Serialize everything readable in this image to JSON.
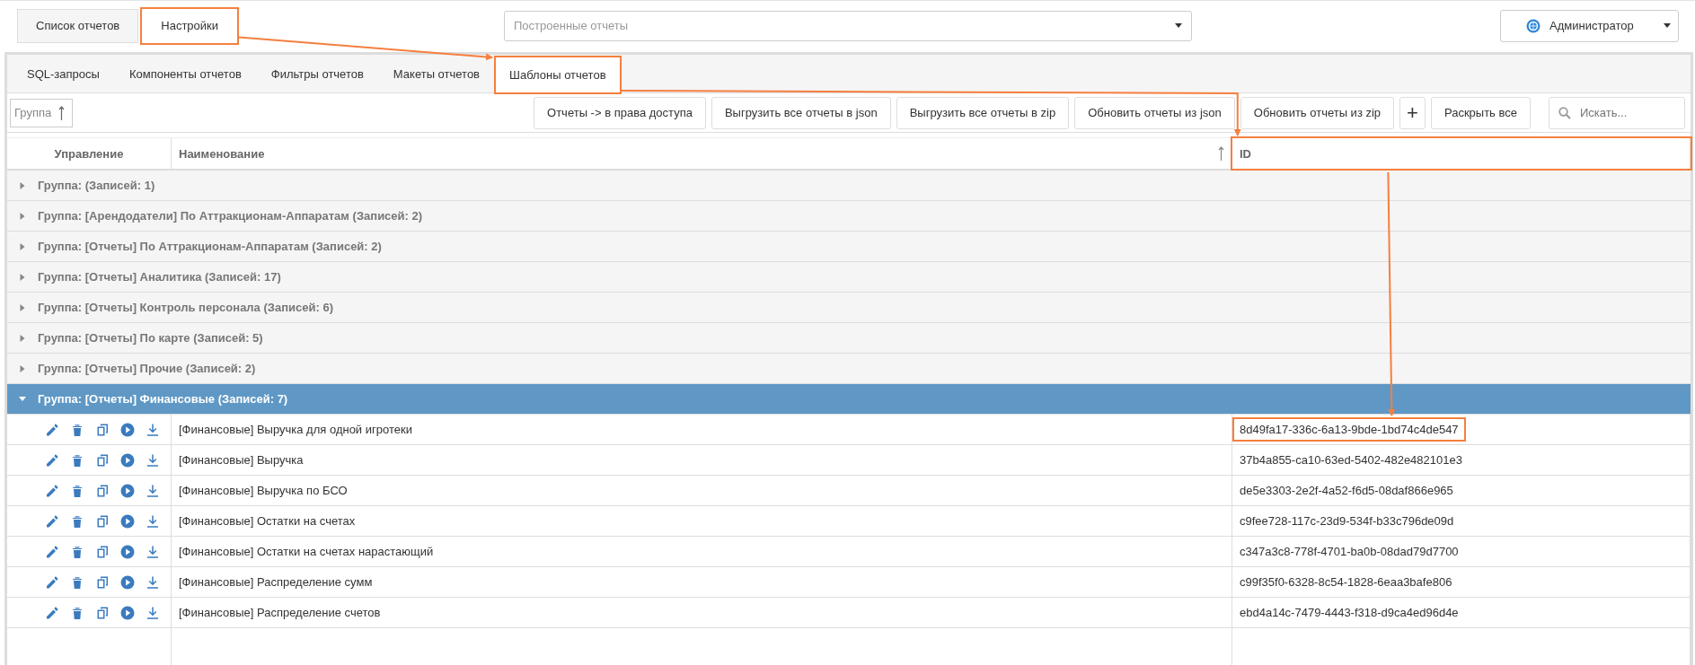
{
  "top_tabs": [
    {
      "label": "Список отчетов",
      "selected": false,
      "highlighted": false
    },
    {
      "label": "Настройки",
      "selected": true,
      "highlighted": true
    }
  ],
  "report_select": {
    "placeholder": "Построенные отчеты"
  },
  "user_menu": {
    "label": "Администратор"
  },
  "settings_tabs": [
    {
      "label": "SQL-запросы",
      "selected": false,
      "highlighted": false
    },
    {
      "label": "Компоненты отчетов",
      "selected": false,
      "highlighted": false
    },
    {
      "label": "Фильтры отчетов",
      "selected": false,
      "highlighted": false
    },
    {
      "label": "Макеты отчетов",
      "selected": false,
      "highlighted": false
    },
    {
      "label": "Шаблоны отчетов",
      "selected": true,
      "highlighted": true
    }
  ],
  "toolbar": {
    "group_chip": {
      "label": "Группа"
    },
    "buttons": [
      {
        "label": "Отчеты -> в права доступа",
        "kind": "text"
      },
      {
        "label": "Выгрузить все отчеты в json",
        "kind": "text"
      },
      {
        "label": "Выгрузить все отчеты в zip",
        "kind": "text"
      },
      {
        "label": "Обновить отчеты из json",
        "kind": "text"
      },
      {
        "label": "Обновить отчеты из zip",
        "kind": "text"
      },
      {
        "label": "+",
        "kind": "symbol"
      },
      {
        "label": "Раскрыть все",
        "kind": "text"
      }
    ],
    "search": {
      "placeholder": "Искать..."
    }
  },
  "table": {
    "columns": [
      {
        "label": "Управление",
        "sorted": false,
        "highlighted": false
      },
      {
        "label": "Наименование",
        "sorted": true,
        "highlighted": false
      },
      {
        "label": "ID",
        "sorted": false,
        "highlighted": true
      }
    ],
    "groups": [
      {
        "label": "Группа: (Записей: 1)",
        "expanded": false
      },
      {
        "label": "Группа: [Арендодатели] По Аттракционам-Аппаратам (Записей: 2)",
        "expanded": false
      },
      {
        "label": "Группа: [Отчеты] По Аттракционам-Аппаратам (Записей: 2)",
        "expanded": false
      },
      {
        "label": "Группа: [Отчеты] Аналитика (Записей: 17)",
        "expanded": false
      },
      {
        "label": "Группа: [Отчеты] Контроль персонала (Записей: 6)",
        "expanded": false
      },
      {
        "label": "Группа: [Отчеты] По карте (Записей: 5)",
        "expanded": false
      },
      {
        "label": "Группа: [Отчеты] Прочие (Записей: 2)",
        "expanded": false
      },
      {
        "label": "Группа: [Отчеты] Финансовые (Записей: 7)",
        "expanded": true,
        "rows": [
          {
            "name": "[Финансовые] Выручка для одной игротеки",
            "id": "8d49fa17-336c-6a13-9bde-1bd74c4de547",
            "id_highlighted": true
          },
          {
            "name": "[Финансовые] Выручка",
            "id": "37b4a855-ca10-63ed-5402-482e482101e3",
            "id_highlighted": false
          },
          {
            "name": "[Финансовые] Выручка по БСО",
            "id": "de5e3303-2e2f-4a52-f6d5-08daf866e965",
            "id_highlighted": false
          },
          {
            "name": "[Финансовые] Остатки на счетах",
            "id": "c9fee728-117c-23d9-534f-b33c796de09d",
            "id_highlighted": false
          },
          {
            "name": "[Финансовые] Остатки на счетах нарастающий",
            "id": "c347a3c8-778f-4701-ba0b-08dad79d7700",
            "id_highlighted": false
          },
          {
            "name": "[Финансовые] Распределение сумм",
            "id": "c99f35f0-6328-8c54-1828-6eaa3bafe806",
            "id_highlighted": false
          },
          {
            "name": "[Финансовые] Распределение счетов",
            "id": "ebd4a14c-7479-4443-f318-d9ca4ed96d4e",
            "id_highlighted": false
          }
        ]
      }
    ]
  }
}
